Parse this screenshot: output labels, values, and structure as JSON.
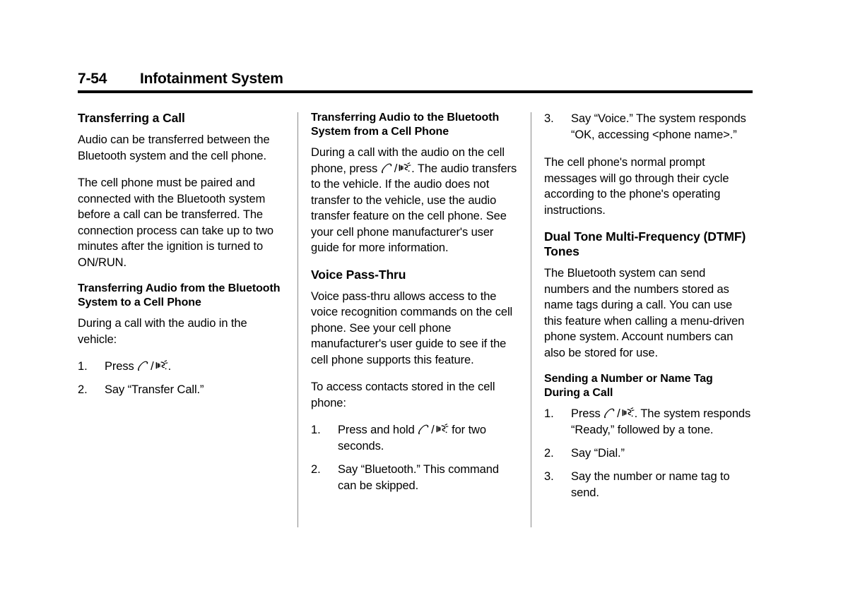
{
  "header": {
    "folio": "7-54",
    "title": "Infotainment System"
  },
  "icons": {
    "phone": "phone-handset-icon",
    "voice": "voice-recognition-icon",
    "separator": "/"
  },
  "columns": [
    {
      "id": "column-1",
      "blocks": [
        {
          "type": "section-heading",
          "text": "Transferring a Call"
        },
        {
          "type": "paragraph",
          "text": "Audio can be transferred between the Bluetooth system and the cell phone."
        },
        {
          "type": "paragraph",
          "text": "The cell phone must be paired and connected with the Bluetooth system before a call can be transferred. The connection process can take up to two minutes after the ignition is turned to ON/RUN."
        },
        {
          "type": "sub-heading",
          "text": "Transferring Audio from the Bluetooth System to a Cell Phone"
        },
        {
          "type": "paragraph",
          "text": "During a call with the audio in the vehicle:"
        },
        {
          "type": "ordered-list",
          "items": [
            {
              "num": "1.",
              "pre": "Press ",
              "has_icons": true,
              "post": "."
            },
            {
              "num": "2.",
              "pre": "Say “Transfer Call.”",
              "has_icons": false,
              "post": ""
            }
          ]
        }
      ]
    },
    {
      "id": "column-2",
      "blocks": [
        {
          "type": "sub-heading",
          "text": "Transferring Audio to the Bluetooth System from a Cell Phone"
        },
        {
          "type": "paragraph-with-icons",
          "pre": "During a call with the audio on the cell phone, press ",
          "has_icons": true,
          "post": ". The audio transfers to the vehicle. If the audio does not transfer to the vehicle, use the audio transfer feature on the cell phone. See your cell phone manufacturer's user guide for more information."
        },
        {
          "type": "section-heading",
          "text": "Voice Pass-Thru"
        },
        {
          "type": "paragraph",
          "text": "Voice pass-thru allows access to the voice recognition commands on the cell phone. See your cell phone manufacturer's user guide to see if the cell phone supports this feature."
        },
        {
          "type": "paragraph",
          "text": "To access contacts stored in the cell phone:"
        },
        {
          "type": "ordered-list",
          "items": [
            {
              "num": "1.",
              "pre": "Press and hold ",
              "has_icons": true,
              "post": " for two seconds."
            },
            {
              "num": "2.",
              "pre": "Say “Bluetooth.” This command can be skipped.",
              "has_icons": false,
              "post": ""
            }
          ]
        }
      ]
    },
    {
      "id": "column-3",
      "blocks": [
        {
          "type": "ordered-list",
          "items": [
            {
              "num": "3.",
              "pre": "Say “Voice.” The system responds “OK, accessing <phone name>.”",
              "has_icons": false,
              "post": ""
            }
          ]
        },
        {
          "type": "paragraph",
          "text": "The cell phone's normal prompt messages will go through their cycle according to the phone's operating instructions."
        },
        {
          "type": "section-heading",
          "text": "Dual Tone Multi-Frequency (DTMF) Tones"
        },
        {
          "type": "paragraph",
          "text": "The Bluetooth system can send numbers and the numbers stored as name tags during a call. You can use this feature when calling a menu-driven phone system. Account numbers can also be stored for use."
        },
        {
          "type": "sub-heading",
          "text": "Sending a Number or Name Tag During a Call"
        },
        {
          "type": "ordered-list",
          "items": [
            {
              "num": "1.",
              "pre": "Press ",
              "has_icons": true,
              "post": ". The system responds “Ready,” followed by a tone."
            },
            {
              "num": "2.",
              "pre": "Say “Dial.”",
              "has_icons": false,
              "post": ""
            },
            {
              "num": "3.",
              "pre": "Say the number or name tag to send.",
              "has_icons": false,
              "post": ""
            }
          ]
        }
      ]
    }
  ]
}
